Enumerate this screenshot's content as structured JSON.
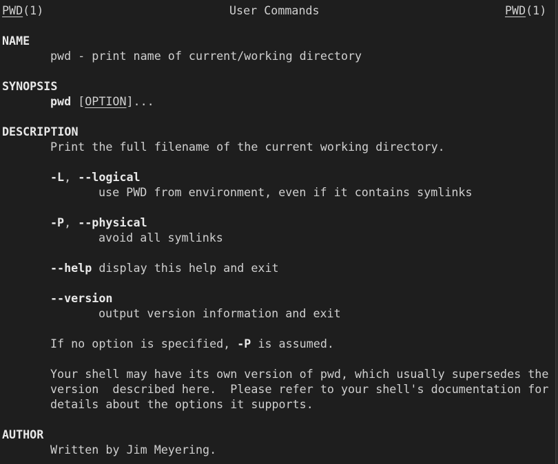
{
  "header": {
    "left_cmd": "PWD",
    "left_sec": "(1)",
    "center": "User Commands",
    "right_cmd": "PWD",
    "right_sec": "(1)"
  },
  "name": {
    "heading": "NAME",
    "text": "pwd - print name of current/working directory"
  },
  "synopsis": {
    "heading": "SYNOPSIS",
    "cmd": "pwd",
    "open_bracket": " [",
    "option": "OPTION",
    "close": "]..."
  },
  "description": {
    "heading": "DESCRIPTION",
    "intro": "Print the full filename of the current working directory.",
    "logical": {
      "short": "-L",
      "sep": ", ",
      "long": "--logical",
      "text": "use PWD from environment, even if it contains symlinks"
    },
    "physical": {
      "short": "-P",
      "sep": ", ",
      "long": "--physical",
      "text": "avoid all symlinks"
    },
    "help": {
      "flag": "--help",
      "text": " display this help and exit"
    },
    "version": {
      "flag": "--version",
      "text": "output version information and exit"
    },
    "default_note": {
      "pre": "If no option is specified, ",
      "flag": "-P",
      "post": " is assumed."
    },
    "shell_note": [
      "Your shell may have its own version of pwd, which usually supersedes the",
      "version  described here.  Please refer to your shell's documentation for",
      "details about the options it supports."
    ]
  },
  "author": {
    "heading": "AUTHOR",
    "text": "Written by Jim Meyering."
  }
}
